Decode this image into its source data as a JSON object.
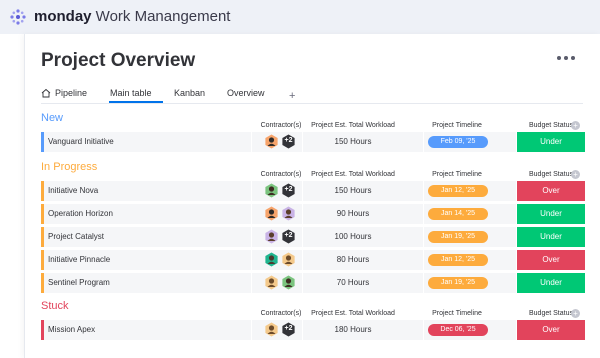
{
  "brand": {
    "name_bold": "monday",
    "name_rest": " Work Manangement"
  },
  "page": {
    "title": "Project Overview"
  },
  "tabs": [
    {
      "label": "Pipeline",
      "icon": "home-icon"
    },
    {
      "label": "Main table",
      "active": true
    },
    {
      "label": "Kanban"
    },
    {
      "label": "Overview"
    }
  ],
  "tab_add": "+",
  "columns": {
    "contractors": "Contractor(s)",
    "workload": "Project Est. Total Workload",
    "timeline": "Project Timeline",
    "budget": "Budget Status",
    "add": "+"
  },
  "colors": {
    "new": "#579bfc",
    "in_progress": "#fdab3d",
    "stuck": "#e2445c",
    "under": "#00c875",
    "over": "#e2445c",
    "pill_blue": "#579bfc",
    "pill_orange": "#fdab3d",
    "pill_red": "#e2445c"
  },
  "groups": {
    "new": {
      "title": "New",
      "rows": [
        {
          "name": "Vanguard Initiative",
          "extra": "+2",
          "hours": "150 Hours",
          "timeline": "Feb 09, '25",
          "budget": "Under"
        }
      ]
    },
    "in_progress": {
      "title": "In Progress",
      "rows": [
        {
          "name": "Initiative Nova",
          "extra": "+2",
          "hours": "150 Hours",
          "timeline": "Jan 12, '25",
          "budget": "Over"
        },
        {
          "name": "Operation Horizon",
          "extra": "",
          "hours": "90 Hours",
          "timeline": "Jan 14, '25",
          "budget": "Under"
        },
        {
          "name": "Project Catalyst",
          "extra": "+2",
          "hours": "100 Hours",
          "timeline": "Jan 19, '25",
          "budget": "Under"
        },
        {
          "name": "Initiative Pinnacle",
          "extra": "",
          "hours": "80 Hours",
          "timeline": "Jan 12, '25",
          "budget": "Over"
        },
        {
          "name": "Sentinel Program",
          "extra": "",
          "hours": "70 Hours",
          "timeline": "Jan 19, '25",
          "budget": "Under"
        }
      ]
    },
    "stuck": {
      "title": "Stuck",
      "rows": [
        {
          "name": "Mission Apex",
          "extra": "+2",
          "hours": "180 Hours",
          "timeline": "Dec 06, '25",
          "budget": "Over"
        }
      ]
    }
  }
}
